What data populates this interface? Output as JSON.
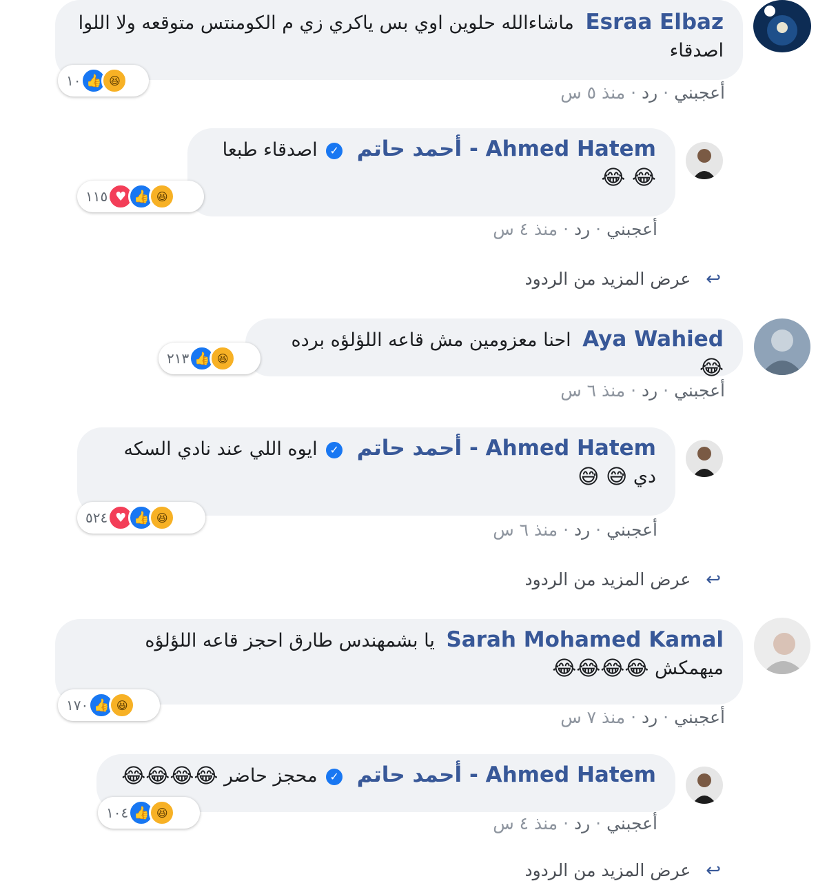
{
  "comments": [
    {
      "author": "Esraa Elbaz",
      "verified": false,
      "text": "ماشاءالله حلوين اوي بس ياكري زي م الكومنتس متوقعه ولا اللوا اصدقاء",
      "emoji": "",
      "reactions": [
        "like",
        "haha"
      ],
      "reaction_count": "١٠",
      "like_label": "أعجبني",
      "reply_label": "رد",
      "time": "منذ ٥ س"
    },
    {
      "author": "Ahmed Hatem - أحمد حاتم",
      "verified": true,
      "text": "اصدقاء طبعا",
      "emoji": "😂 😂",
      "reactions": [
        "love",
        "like",
        "haha"
      ],
      "reaction_count": "١١٥",
      "like_label": "أعجبني",
      "reply_label": "رد",
      "time": "منذ ٤ س",
      "more_replies": "عرض المزيد من الردود"
    },
    {
      "author": "Aya Wahied",
      "verified": false,
      "text": "احنا معزومين مش قاعه اللؤلؤه برده",
      "emoji": "😂",
      "reactions": [
        "like",
        "haha"
      ],
      "reaction_count": "٢١٣",
      "like_label": "أعجبني",
      "reply_label": "رد",
      "time": "منذ ٦ س"
    },
    {
      "author": "Ahmed Hatem - أحمد حاتم",
      "verified": true,
      "text": "ايوه اللي عند نادي السكه دي",
      "emoji": "😅 😅",
      "reactions": [
        "love",
        "like",
        "haha"
      ],
      "reaction_count": "٥٢٤",
      "like_label": "أعجبني",
      "reply_label": "رد",
      "time": "منذ ٦ س",
      "more_replies": "عرض المزيد من الردود"
    },
    {
      "author": "Sarah Mohamed Kamal",
      "verified": false,
      "text": "يا بشمهندس طارق احجز قاعه اللؤلؤه ميهمكش",
      "emoji": "😂😂😂😂",
      "reactions": [
        "like",
        "haha"
      ],
      "reaction_count": "١٧٠",
      "like_label": "أعجبني",
      "reply_label": "رد",
      "time": "منذ ٧ س"
    },
    {
      "author": "Ahmed Hatem - أحمد حاتم",
      "verified": true,
      "text": "محجز حاضر",
      "emoji": "😂😂😂😂",
      "reactions": [
        "like",
        "haha"
      ],
      "reaction_count": "١٠٤",
      "like_label": "أعجبني",
      "reply_label": "رد",
      "time": "منذ ٤ س",
      "more_replies": "عرض المزيد من الردود"
    }
  ],
  "colors": {
    "author": "#385898",
    "bubble": "#f0f2f5",
    "like": "#1877f2",
    "love": "#f33e58",
    "haha": "#f7b125",
    "meta": "#8d949e"
  },
  "icons": {
    "like": "like-icon",
    "love": "love-icon",
    "haha": "haha-icon",
    "verified": "verified-badge-icon",
    "reply_arrow": "reply-arrow-icon"
  }
}
